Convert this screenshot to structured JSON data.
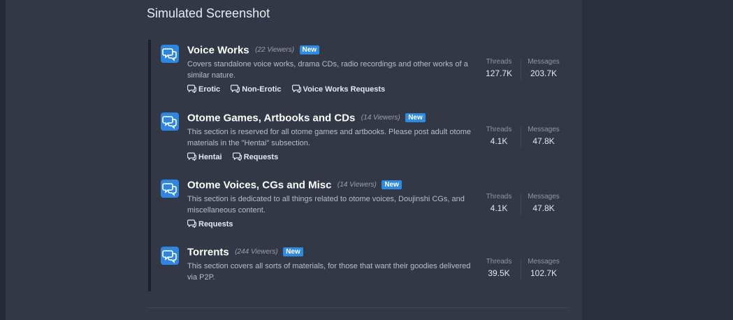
{
  "page": {
    "title": "Simulated Screenshot"
  },
  "labels": {
    "threads": "Threads",
    "messages": "Messages",
    "new_badge": "New"
  },
  "nodes": [
    {
      "title": "Voice Works",
      "viewers": "(22 Viewers)",
      "description": "Covers standalone voice works, drama CDs, radio recordings and other works of a similar nature.",
      "subforums": [
        "Erotic",
        "Non-Erotic",
        "Voice Works Requests"
      ],
      "threads": "127.7K",
      "messages": "203.7K"
    },
    {
      "title": "Otome Games, Artbooks and CDs",
      "viewers": "(14 Viewers)",
      "description": "This section is reserved for all otome games and artbooks. Please post adult otome materials in the \"Hentai\" subsection.",
      "subforums": [
        "Hentai",
        "Requests"
      ],
      "threads": "4.1K",
      "messages": "47.8K"
    },
    {
      "title": "Otome Voices, CGs and Misc",
      "viewers": "(14 Viewers)",
      "description": "This section is dedicated to all things related to otome voices, Doujinshi CGs, and miscellaneous content.",
      "subforums": [
        "Requests"
      ],
      "threads": "4.1K",
      "messages": "47.8K"
    },
    {
      "title": "Torrents",
      "viewers": "(244 Viewers)",
      "description": "This section covers all sorts of materials, for those that want their goodies delivered via P2P.",
      "subforums": [],
      "threads": "39.5K",
      "messages": "102.7K"
    }
  ],
  "icons": {
    "node_icon": "chat-bubbles-icon",
    "subforum_icon": "chat-bubble-icon"
  },
  "colors": {
    "accent": "#2e86de",
    "background": "#323845"
  }
}
